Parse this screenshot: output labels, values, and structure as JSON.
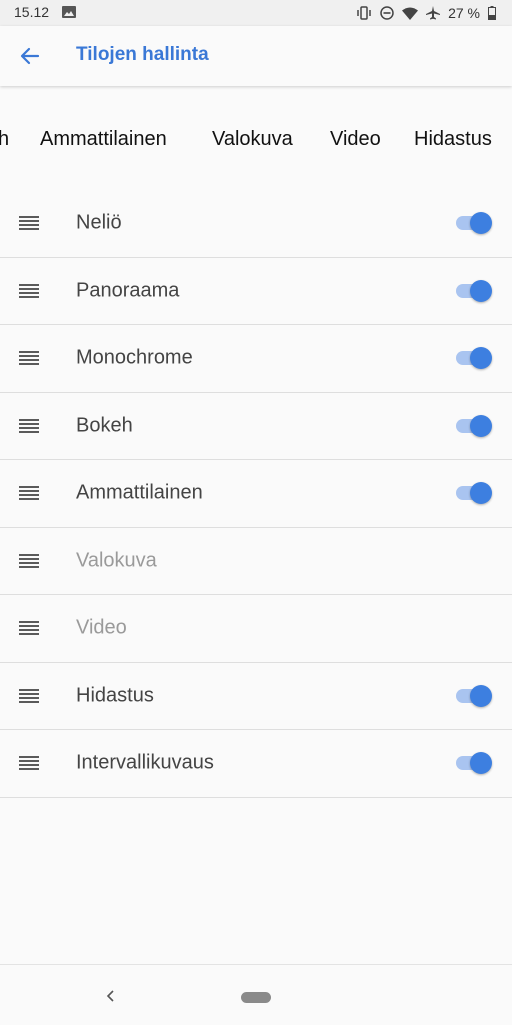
{
  "status_bar": {
    "time": "15.12",
    "battery_percent": "27 %",
    "icons": [
      "image-icon",
      "vibrate-icon",
      "do-not-disturb-icon",
      "wifi-icon",
      "airplane-icon",
      "battery-icon"
    ]
  },
  "app_bar": {
    "title": "Tilojen hallinta",
    "back_icon": "arrow-back-icon",
    "accent_color": "#3a78d6"
  },
  "mode_strip": [
    "h",
    "Ammattilainen",
    "Valokuva",
    "Video",
    "Hidastus"
  ],
  "modes": [
    {
      "label": "Neliö",
      "enabled": true,
      "has_toggle": true
    },
    {
      "label": "Panoraama",
      "enabled": true,
      "has_toggle": true
    },
    {
      "label": "Monochrome",
      "enabled": true,
      "has_toggle": true
    },
    {
      "label": "Bokeh",
      "enabled": true,
      "has_toggle": true
    },
    {
      "label": "Ammattilainen",
      "enabled": true,
      "has_toggle": true
    },
    {
      "label": "Valokuva",
      "enabled": false,
      "has_toggle": false
    },
    {
      "label": "Video",
      "enabled": false,
      "has_toggle": false
    },
    {
      "label": "Hidastus",
      "enabled": true,
      "has_toggle": true
    },
    {
      "label": "Intervallikuvaus",
      "enabled": true,
      "has_toggle": true
    }
  ],
  "nav_bar": {
    "back_icon": "nav-back-icon",
    "home_icon": "home-pill-icon"
  },
  "colors": {
    "toggle_thumb_on": "#3d7fe0",
    "toggle_track_on": "#a9c4f0",
    "disabled_text": "#9a9a9a"
  }
}
